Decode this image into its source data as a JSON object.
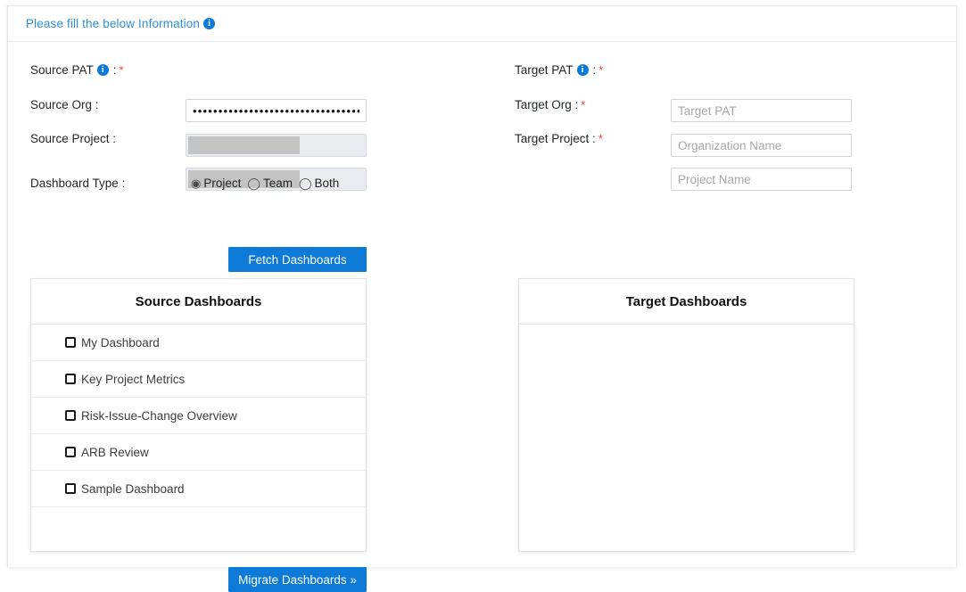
{
  "header": {
    "title": "Please fill the below Information",
    "info_icon": "info-icon"
  },
  "form": {
    "source": {
      "pat": {
        "label": "Source PAT",
        "separator": ":",
        "required": true,
        "info_icon": "info-icon",
        "value": "••••••••••••••••••••••••••••••••••",
        "masked": true
      },
      "org": {
        "label": "Source Org :",
        "required": false,
        "value": "",
        "readonly": true,
        "redacted": true
      },
      "project": {
        "label": "Source Project :",
        "required": false,
        "value": "",
        "readonly": true,
        "redacted": true
      }
    },
    "target": {
      "pat": {
        "label": "Target PAT",
        "separator": ":",
        "required": true,
        "info_icon": "info-icon",
        "value": "",
        "placeholder": "Target PAT"
      },
      "org": {
        "label": "Target Org :",
        "required": true,
        "value": "",
        "placeholder": "Organization Name"
      },
      "project": {
        "label": "Target Project :",
        "required": true,
        "value": "",
        "placeholder": "Project Name"
      }
    },
    "dashboard_type": {
      "label": "Dashboard Type :",
      "selected": "Project",
      "options": [
        {
          "label": "Project",
          "selected": true
        },
        {
          "label": "Team",
          "selected": false
        },
        {
          "label": "Both",
          "selected": false
        }
      ]
    },
    "fetch_button": "Fetch Dashboards",
    "migrate_button": "Migrate Dashboards »"
  },
  "source_panel": {
    "title": "Source Dashboards",
    "items": [
      {
        "label": "My Dashboard",
        "checked": false
      },
      {
        "label": "Key Project Metrics",
        "checked": false
      },
      {
        "label": "Risk-Issue-Change Overview",
        "checked": false
      },
      {
        "label": "ARB Review",
        "checked": false
      },
      {
        "label": "Sample Dashboard",
        "checked": false
      }
    ]
  },
  "target_panel": {
    "title": "Target Dashboards",
    "items": []
  },
  "colors": {
    "accent_blue": "#0d7ad8",
    "link_blue": "#2f8fd8",
    "required_red": "#f23b3b",
    "disabled_bg": "#e9ecef",
    "redaction_gray": "#c3c3c3"
  }
}
